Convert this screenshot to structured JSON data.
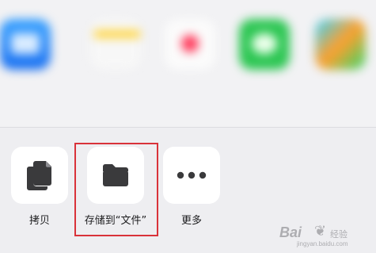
{
  "share_sheet": {
    "apps": [
      {
        "icon": "mail-icon",
        "color": "#1a6ff0"
      },
      {
        "icon": "notes-icon",
        "color": "#ffd43b"
      },
      {
        "icon": "health-icon",
        "color": "#ff3b5c"
      },
      {
        "icon": "wechat-icon",
        "color": "#2dc653"
      },
      {
        "icon": "video-app-icon",
        "color": "#ff9f2d"
      }
    ],
    "actions": [
      {
        "icon": "copy-icon",
        "label": "拷贝"
      },
      {
        "icon": "folder-icon",
        "label": "存储到“文件”"
      },
      {
        "icon": "more-icon",
        "label": "更多"
      }
    ]
  },
  "annotation": {
    "color": "#d9323a"
  },
  "watermark": {
    "brand": "Bai",
    "sub": "经验",
    "url": "jingyan.baidu.com"
  }
}
